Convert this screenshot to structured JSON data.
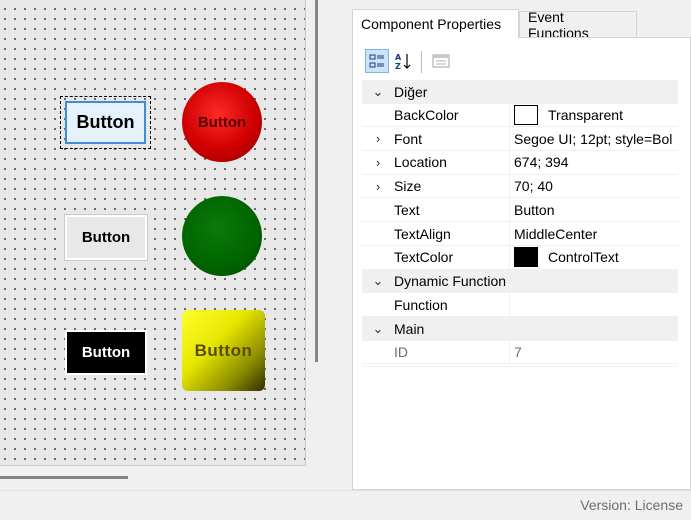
{
  "canvas": {
    "button_1": "Button",
    "button_2": "Button",
    "button_3": "Button",
    "circle_red": "Button",
    "square_yellow": "Button"
  },
  "tabs": [
    {
      "label": "Component Properties",
      "active": true
    },
    {
      "label": "Event Functions",
      "active": false
    }
  ],
  "toolbar": {
    "categorized_icon": "categorized-icon",
    "alphabetical_icon": "alphabetical-icon",
    "property_pages_icon": "property-pages-icon"
  },
  "property_grid": {
    "categories": [
      {
        "name": "Diğer",
        "expanded": true,
        "properties": [
          {
            "name": "BackColor",
            "value": "Transparent",
            "swatch": "#ffffff",
            "expandable": false
          },
          {
            "name": "Font",
            "value": "Segoe UI; 12pt; style=Bol",
            "expandable": true
          },
          {
            "name": "Location",
            "value": "674; 394",
            "expandable": true
          },
          {
            "name": "Size",
            "value": "70; 40",
            "expandable": true
          },
          {
            "name": "Text",
            "value": "Button",
            "expandable": false
          },
          {
            "name": "TextAlign",
            "value": "MiddleCenter",
            "expandable": false
          },
          {
            "name": "TextColor",
            "value": "ControlText",
            "swatch": "#000000",
            "expandable": false
          }
        ]
      },
      {
        "name": "Dynamic Function",
        "expanded": true,
        "properties": [
          {
            "name": "Function",
            "value": "",
            "expandable": false
          }
        ]
      },
      {
        "name": "Main",
        "expanded": true,
        "properties": [
          {
            "name": "ID",
            "value": "7",
            "readonly": true,
            "expandable": false
          }
        ]
      }
    ]
  },
  "colors": {
    "selected_button_bg": "#e5f1fb",
    "selected_button_border": "#3d8ed8",
    "red_circle": "#d00000",
    "green_circle": "#006400",
    "yellow_square": "#e6e600"
  },
  "status": {
    "text": "Version: License"
  }
}
